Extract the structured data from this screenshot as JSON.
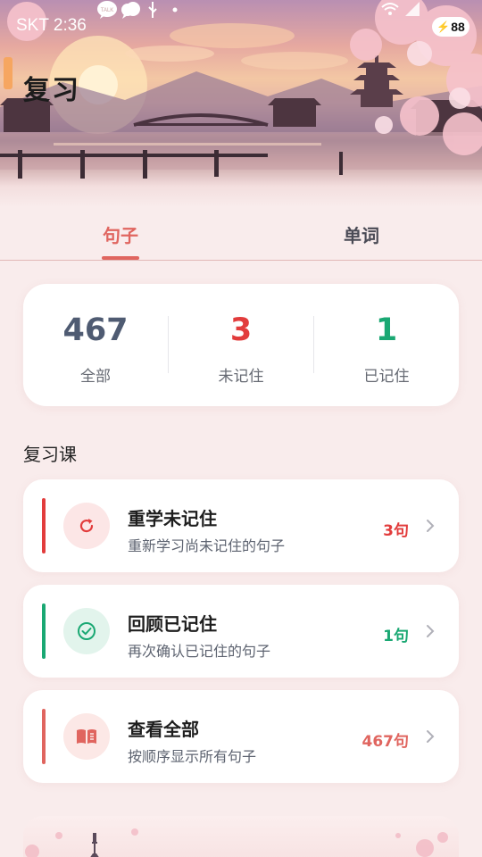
{
  "status_bar": {
    "carrier": "SKT",
    "time": "2:36",
    "battery": "88",
    "talk_badge": "TALK",
    "icons": [
      "kakaotalk-icon",
      "cloud-chat-icon",
      "usb-icon",
      "dot-icon",
      "wifi-icon",
      "signal-icon",
      "battery-icon"
    ]
  },
  "header": {
    "title": "复习"
  },
  "tabs": [
    {
      "label": "句子",
      "active": true
    },
    {
      "label": "单词",
      "active": false
    }
  ],
  "stats": [
    {
      "value": "467",
      "label": "全部",
      "color": "#4f5b72"
    },
    {
      "value": "3",
      "label": "未记住",
      "color": "#e23c3c"
    },
    {
      "value": "1",
      "label": "已记住",
      "color": "#1aa873"
    }
  ],
  "section": {
    "title": "复习课"
  },
  "courses": [
    {
      "title": "重学未记住",
      "subtitle": "重新学习尚未记住的句子",
      "count": "3句",
      "accent": "#e23c3c",
      "icon": "refresh-icon"
    },
    {
      "title": "回顾已记住",
      "subtitle": "再次确认已记住的句子",
      "count": "1句",
      "accent": "#1aa873",
      "icon": "check-circle-icon"
    },
    {
      "title": "查看全部",
      "subtitle": "按顺序显示所有句子",
      "count": "467句",
      "accent": "#e0655f",
      "icon": "open-book-icon"
    }
  ],
  "colors": {
    "accent": "#e0655f",
    "background": "#f9ecec"
  }
}
